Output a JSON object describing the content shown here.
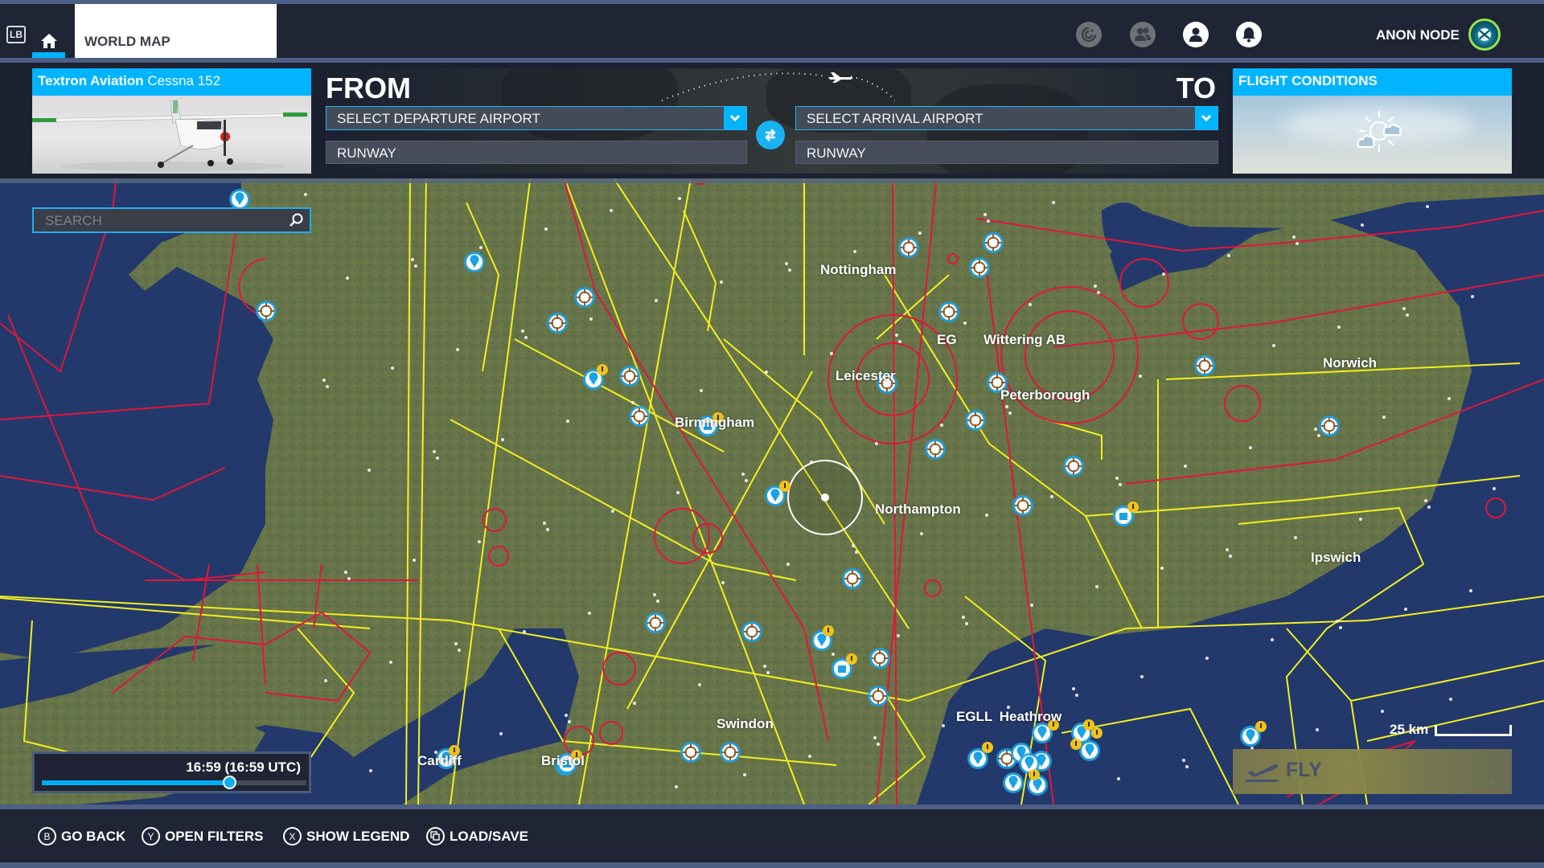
{
  "header": {
    "lb_label": "LB",
    "tabs": [
      {
        "id": "home",
        "icon": "home-icon",
        "active": true
      },
      {
        "id": "world-map",
        "label": "WORLD MAP"
      }
    ],
    "icons": [
      "activity-icon",
      "friends-icon",
      "profile-icon",
      "notifications-icon"
    ],
    "username": "ANON NODE",
    "avatar_icon": "xbox-icon"
  },
  "aircraft": {
    "manufacturer": "Textron Aviation",
    "model": "Cessna 152"
  },
  "route": {
    "from_label": "FROM",
    "to_label": "TO",
    "departure_placeholder": "SELECT DEPARTURE AIRPORT",
    "arrival_placeholder": "SELECT ARRIVAL AIRPORT",
    "departure_runway": "RUNWAY",
    "arrival_runway": "RUNWAY",
    "swap_icon": "swap-icon"
  },
  "conditions": {
    "title": "FLIGHT CONDITIONS",
    "icon": "partly-cloudy-icon"
  },
  "search": {
    "placeholder": "SEARCH",
    "value": ""
  },
  "time": {
    "label": "16:59 (16:59 UTC)",
    "fraction": 0.707
  },
  "scale": {
    "label": "25 km"
  },
  "fly": {
    "label": "FLY",
    "enabled": false
  },
  "map": {
    "colors": {
      "sea": "#23396b",
      "land": "#6b7a4a",
      "airspace_red": "#e0163c",
      "airspace_yellow": "#f2f01e",
      "marker_blue": "#1aa3e6"
    },
    "cities": [
      {
        "name": "Nottingham"
      },
      {
        "name": "Leicester"
      },
      {
        "name": "Birmingham"
      },
      {
        "name": "Peterborough"
      },
      {
        "name": "Northampton"
      },
      {
        "name": "Norwich"
      },
      {
        "name": "Ipswich"
      },
      {
        "name": "Swindon"
      },
      {
        "name": "Cardiff"
      },
      {
        "name": "Bristol"
      }
    ],
    "airports": [
      {
        "icao": "EG",
        "name": "Wittering AB"
      },
      {
        "icao": "EGLL",
        "name": "Heathrow"
      }
    ]
  },
  "bottom_bar": [
    {
      "button": "B",
      "label": "GO BACK"
    },
    {
      "button": "Y",
      "label": "OPEN FILTERS"
    },
    {
      "button": "X",
      "label": "SHOW LEGEND"
    },
    {
      "button": "view",
      "label": "LOAD/SAVE"
    }
  ]
}
